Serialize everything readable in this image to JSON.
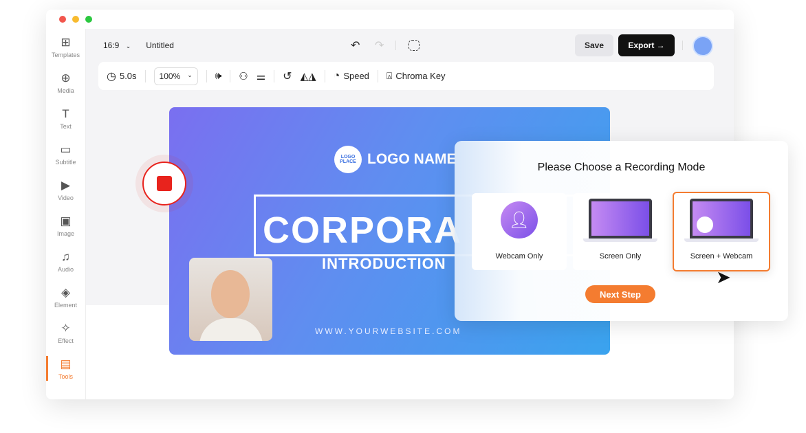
{
  "window": {
    "traffic_lights": [
      "#f2564d",
      "#f8bb2f",
      "#2bc840"
    ]
  },
  "sidebar": {
    "items": [
      {
        "label": "Templates",
        "icon": "templates-icon"
      },
      {
        "label": "Media",
        "icon": "media-icon"
      },
      {
        "label": "Text",
        "icon": "text-icon"
      },
      {
        "label": "Subtitle",
        "icon": "subtitle-icon"
      },
      {
        "label": "Video",
        "icon": "video-icon"
      },
      {
        "label": "Image",
        "icon": "image-icon"
      },
      {
        "label": "Audio",
        "icon": "audio-icon"
      },
      {
        "label": "Element",
        "icon": "element-icon"
      },
      {
        "label": "Effect",
        "icon": "effect-icon"
      },
      {
        "label": "Tools",
        "icon": "tools-icon",
        "active": true
      }
    ]
  },
  "header": {
    "aspect": "16:9",
    "title": "Untitled",
    "save": "Save",
    "export": "Export →"
  },
  "toolbar": {
    "duration": "5.0s",
    "zoom": "100%",
    "speed": "Speed",
    "chroma": "Chroma Key"
  },
  "canvas": {
    "logo_badge": "LOGO PLACE",
    "logo_name": "LOGO NAME",
    "headline": "CORPORA",
    "subhead": "INTRODUCTION",
    "website": "WWW.YOURWEBSITE.COM"
  },
  "modal": {
    "title": "Please Choose a Recording Mode",
    "options": [
      "Webcam Only",
      "Screen Only",
      "Screen + Webcam"
    ],
    "selected": 2,
    "next": "Next Step"
  },
  "colors": {
    "accent": "#f47c30",
    "record": "#e8231d"
  }
}
